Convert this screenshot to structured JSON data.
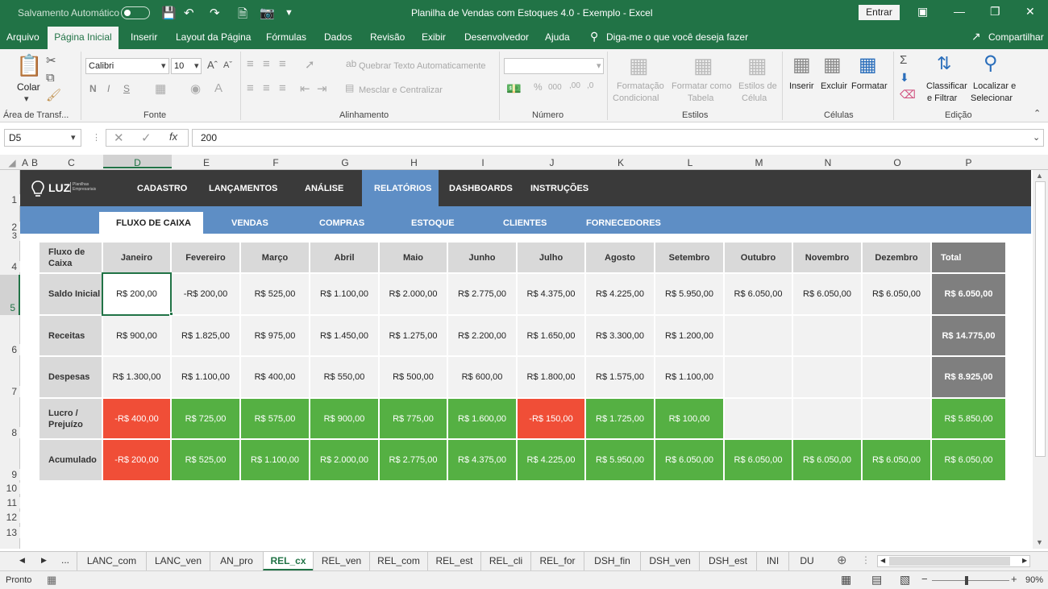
{
  "titlebar": {
    "autosave": "Salvamento Automático",
    "title": "Planilha de Vendas com Estoques 4.0 - Exemplo  -  Excel",
    "signin": "Entrar"
  },
  "menu": {
    "tabs": [
      "Arquivo",
      "Página Inicial",
      "Inserir",
      "Layout da Página",
      "Fórmulas",
      "Dados",
      "Revisão",
      "Exibir",
      "Desenvolvedor",
      "Ajuda"
    ],
    "tell": "Diga-me o que você deseja fazer",
    "share": "Compartilhar"
  },
  "ribbon": {
    "paste": "Colar",
    "clipboard": "Área de Transf...",
    "font_name": "Calibri",
    "font_size": "10",
    "font_group": "Fonte",
    "wrap": "Quebrar Texto Automaticamente",
    "merge": "Mesclar e Centralizar",
    "align_group": "Alinhamento",
    "number_group": "Número",
    "cond1": "Formatação",
    "cond2": "Condicional",
    "table1": "Formatar como",
    "table2": "Tabela",
    "styles1": "Estilos de",
    "styles2": "Célula",
    "styles_group": "Estilos",
    "insert": "Inserir",
    "delete": "Excluir",
    "format": "Formatar",
    "cells_group": "Células",
    "sort1": "Classificar",
    "sort2": "e Filtrar",
    "find1": "Localizar e",
    "find2": "Selecionar",
    "edit_group": "Edição",
    "bold": "N",
    "italic": "I",
    "underline": "S"
  },
  "formula": {
    "namebox": "D5",
    "value": "200"
  },
  "columns": [
    "A",
    "B",
    "C",
    "D",
    "E",
    "F",
    "G",
    "H",
    "I",
    "J",
    "K",
    "L",
    "M",
    "N",
    "O",
    "P"
  ],
  "rows": [
    "1",
    "2",
    "3",
    "4",
    "5",
    "6",
    "7",
    "8",
    "9",
    "10",
    "11",
    "12",
    "13"
  ],
  "nav": {
    "brand": "LUZ",
    "brand_sub": "Planilhas Empresariais",
    "items": [
      "CADASTRO",
      "LANÇAMENTOS",
      "ANÁLISE",
      "RELATÓRIOS",
      "DASHBOARDS",
      "INSTRUÇÕES"
    ],
    "active": "RELATÓRIOS"
  },
  "subnav": {
    "items": [
      "FLUXO DE CAIXA",
      "VENDAS",
      "COMPRAS",
      "ESTOQUE",
      "CLIENTES",
      "FORNECEDORES"
    ],
    "active": "FLUXO DE CAIXA"
  },
  "table": {
    "corner": "Fluxo de Caixa",
    "months": [
      "Janeiro",
      "Fevereiro",
      "Março",
      "Abril",
      "Maio",
      "Junho",
      "Julho",
      "Agosto",
      "Setembro",
      "Outubro",
      "Novembro",
      "Dezembro"
    ],
    "total_header": "Total",
    "rows": [
      {
        "label": "Saldo Inicial",
        "values": [
          "R$ 200,00",
          "-R$ 200,00",
          "R$ 525,00",
          "R$ 1.100,00",
          "R$ 2.000,00",
          "R$ 2.775,00",
          "R$ 4.375,00",
          "R$ 4.225,00",
          "R$ 5.950,00",
          "R$ 6.050,00",
          "R$ 6.050,00",
          "R$ 6.050,00"
        ],
        "total": "R$ 6.050,00"
      },
      {
        "label": "Receitas",
        "values": [
          "R$ 900,00",
          "R$ 1.825,00",
          "R$ 975,00",
          "R$ 1.450,00",
          "R$ 1.275,00",
          "R$ 2.200,00",
          "R$ 1.650,00",
          "R$ 3.300,00",
          "R$ 1.200,00",
          "",
          "",
          ""
        ],
        "total": "R$ 14.775,00"
      },
      {
        "label": "Despesas",
        "values": [
          "R$ 1.300,00",
          "R$ 1.100,00",
          "R$ 400,00",
          "R$ 550,00",
          "R$ 500,00",
          "R$ 600,00",
          "R$ 1.800,00",
          "R$ 1.575,00",
          "R$ 1.100,00",
          "",
          "",
          ""
        ],
        "total": "R$ 8.925,00"
      },
      {
        "label": "Lucro / Prejuízo",
        "values": [
          "-R$ 400,00",
          "R$ 725,00",
          "R$ 575,00",
          "R$ 900,00",
          "R$ 775,00",
          "R$ 1.600,00",
          "-R$ 150,00",
          "R$ 1.725,00",
          "R$ 100,00",
          "",
          "",
          ""
        ],
        "total": "R$ 5.850,00"
      },
      {
        "label": "Acumulado",
        "values": [
          "-R$ 200,00",
          "R$ 525,00",
          "R$ 1.100,00",
          "R$ 2.000,00",
          "R$ 2.775,00",
          "R$ 4.375,00",
          "R$ 4.225,00",
          "R$ 5.950,00",
          "R$ 6.050,00",
          "R$ 6.050,00",
          "R$ 6.050,00",
          "R$ 6.050,00"
        ],
        "total": "R$ 6.050,00"
      }
    ]
  },
  "sheets": {
    "ellipsis": "...",
    "tabs": [
      "LANC_com",
      "LANC_ven",
      "AN_pro",
      "REL_cx",
      "REL_ven",
      "REL_com",
      "REL_est",
      "REL_cli",
      "REL_for",
      "DSH_fin",
      "DSH_ven",
      "DSH_est",
      "INI",
      "DU"
    ],
    "active": "REL_cx"
  },
  "status": {
    "ready": "Pronto",
    "zoom": "90%"
  },
  "colors": {
    "excel_green": "#217346",
    "positive": "#55b043",
    "negative": "#f04e37",
    "nav_dark": "#3a3a3a",
    "nav_blue": "#5e8ec5",
    "total": "#7f7f7f"
  }
}
